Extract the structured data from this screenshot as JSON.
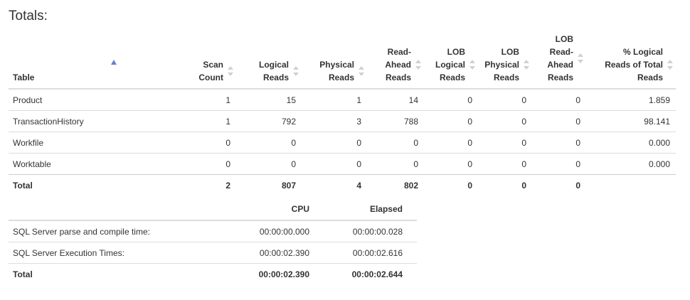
{
  "heading": "Totals:",
  "stats_table": {
    "columns": [
      {
        "key": "table",
        "label": "Table"
      },
      {
        "key": "scan",
        "label": "Scan Count"
      },
      {
        "key": "logical",
        "label": "Logical Reads"
      },
      {
        "key": "physical",
        "label": "Physical Reads"
      },
      {
        "key": "readahead",
        "label": "Read-Ahead Reads"
      },
      {
        "key": "lob_logical",
        "label": "LOB Logical Reads"
      },
      {
        "key": "lob_physical",
        "label": "LOB Physical Reads"
      },
      {
        "key": "lob_readahead",
        "label": "LOB Read-Ahead Reads"
      },
      {
        "key": "pct",
        "label": "% Logical Reads of Total Reads"
      }
    ],
    "rows": [
      [
        "Product",
        "1",
        "15",
        "1",
        "14",
        "0",
        "0",
        "0",
        "1.859"
      ],
      [
        "TransactionHistory",
        "1",
        "792",
        "3",
        "788",
        "0",
        "0",
        "0",
        "98.141"
      ],
      [
        "Workfile",
        "0",
        "0",
        "0",
        "0",
        "0",
        "0",
        "0",
        "0.000"
      ],
      [
        "Worktable",
        "0",
        "0",
        "0",
        "0",
        "0",
        "0",
        "0",
        "0.000"
      ]
    ],
    "total": [
      "Total",
      "2",
      "807",
      "4",
      "802",
      "0",
      "0",
      "0",
      ""
    ]
  },
  "times_table": {
    "columns": [
      "",
      "CPU",
      "Elapsed"
    ],
    "rows": [
      [
        "SQL Server parse and compile time:",
        "00:00:00.000",
        "00:00:00.028"
      ],
      [
        "SQL Server Execution Times:",
        "00:00:02.390",
        "00:00:02.616"
      ]
    ],
    "total": [
      "Total",
      "00:00:02.390",
      "00:00:02.644"
    ]
  },
  "icons": {
    "sort_active": "sort-ascending-icon",
    "sort_inactive": "sort-both-icon"
  },
  "colors": {
    "sort_active": "#6a7fc4",
    "sort_inactive": "#d0d0d0",
    "border": "#dddddd"
  }
}
